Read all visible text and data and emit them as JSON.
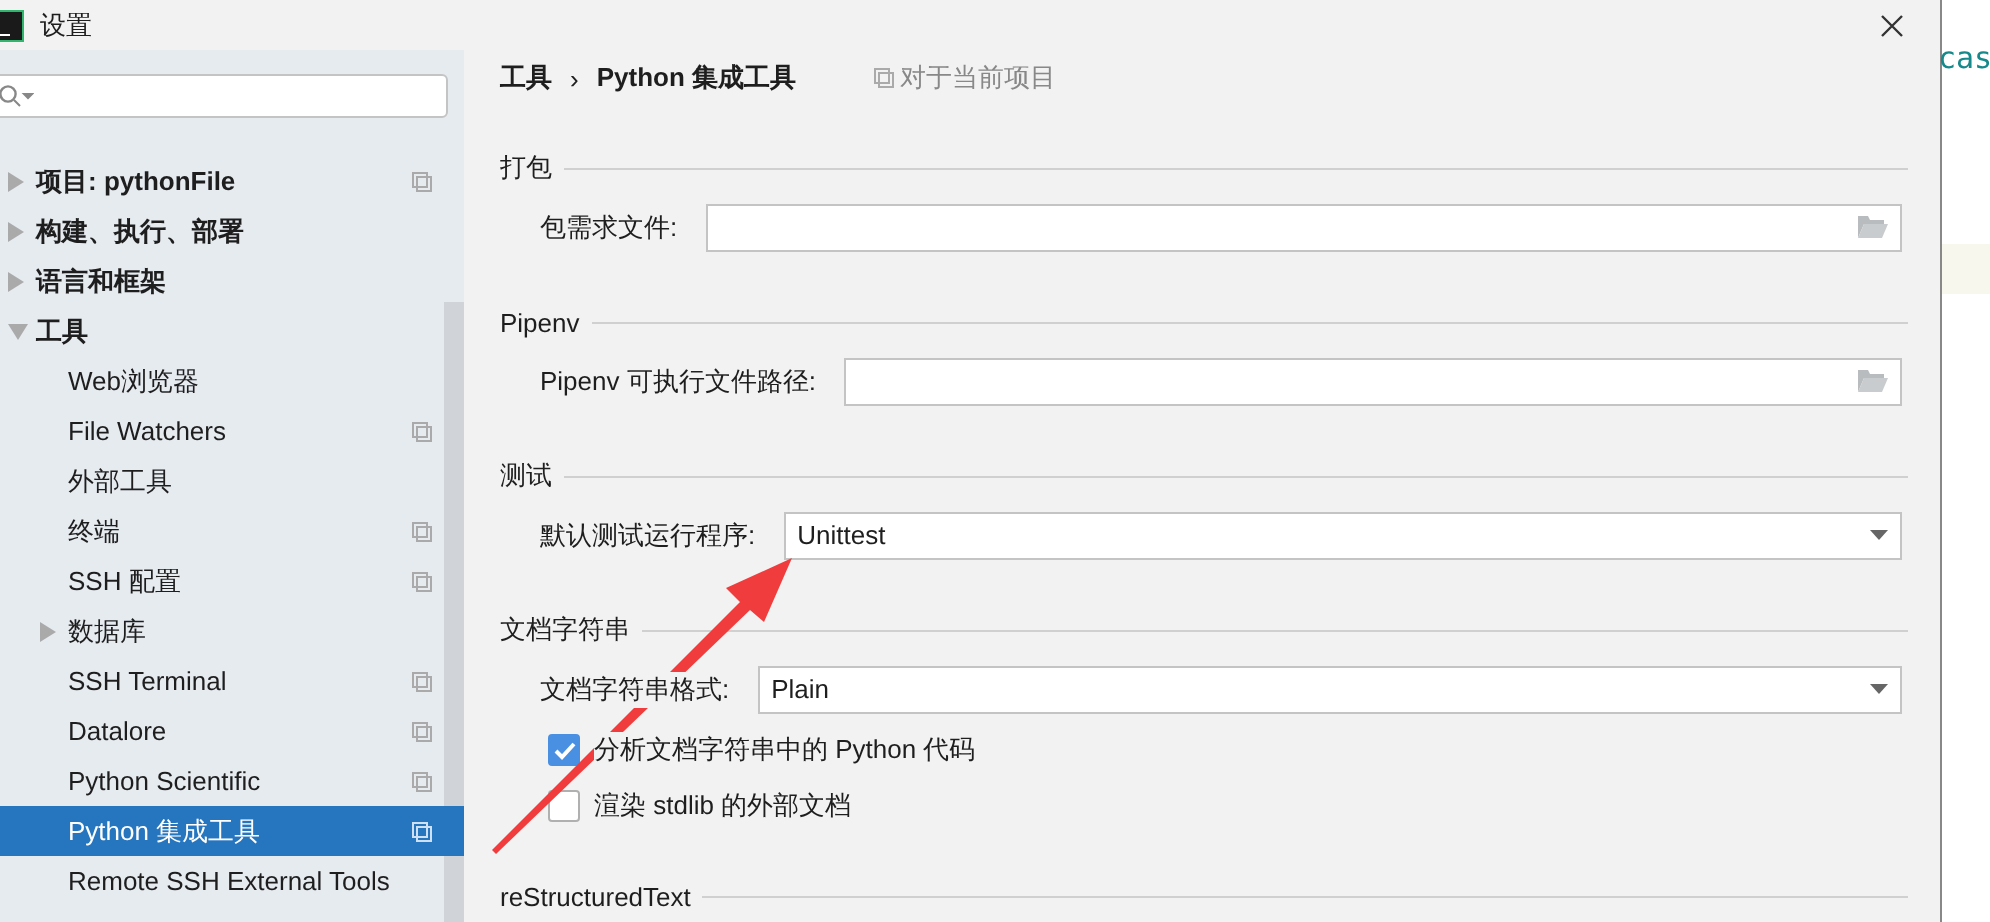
{
  "window": {
    "title": "设置"
  },
  "sidebar": {
    "items": [
      {
        "label": "项目: pythonFile",
        "expanded": false,
        "per_project": true,
        "selected": false
      },
      {
        "label": "构建、执行、部署",
        "expanded": false,
        "per_project": false,
        "selected": false
      },
      {
        "label": "语言和框架",
        "expanded": false,
        "per_project": false,
        "selected": false
      },
      {
        "label": "工具",
        "expanded": true,
        "per_project": false,
        "selected": false,
        "children": [
          {
            "label": "Web浏览器",
            "per_project": false,
            "selected": false
          },
          {
            "label": "File Watchers",
            "per_project": true,
            "selected": false
          },
          {
            "label": "外部工具",
            "per_project": false,
            "selected": false
          },
          {
            "label": "终端",
            "per_project": true,
            "selected": false
          },
          {
            "label": "SSH 配置",
            "per_project": true,
            "selected": false
          },
          {
            "label": "数据库",
            "expanded": false,
            "per_project": false,
            "selected": false
          },
          {
            "label": "SSH Terminal",
            "per_project": true,
            "selected": false
          },
          {
            "label": "Datalore",
            "per_project": true,
            "selected": false
          },
          {
            "label": "Python Scientific",
            "per_project": true,
            "selected": false
          },
          {
            "label": "Python 集成工具",
            "per_project": true,
            "selected": true
          },
          {
            "label": "Remote SSH External Tools",
            "per_project": false,
            "selected": false
          }
        ]
      }
    ]
  },
  "breadcrumb": {
    "parent": "工具",
    "separator": "›",
    "current": "Python 集成工具",
    "scope": "对于当前项目"
  },
  "sections": [
    {
      "title": "打包",
      "rows": [
        {
          "kind": "path",
          "label": "包需求文件:"
        }
      ]
    },
    {
      "title": "Pipenv",
      "rows": [
        {
          "kind": "path",
          "label": "Pipenv 可执行文件路径:"
        }
      ]
    },
    {
      "title": "测试",
      "rows": [
        {
          "kind": "select",
          "label": "默认测试运行程序:",
          "value": "Unittest"
        }
      ]
    },
    {
      "title": "文档字符串",
      "rows": [
        {
          "kind": "select",
          "label": "文档字符串格式:",
          "value": "Plain"
        },
        {
          "kind": "checkbox",
          "label": "分析文档字符串中的 Python 代码",
          "checked": true
        },
        {
          "kind": "checkbox",
          "label": "渲染 stdlib 的外部文档",
          "checked": false
        }
      ]
    },
    {
      "title": "reStructuredText"
    }
  ],
  "background_editor": {
    "text": "cas"
  }
}
